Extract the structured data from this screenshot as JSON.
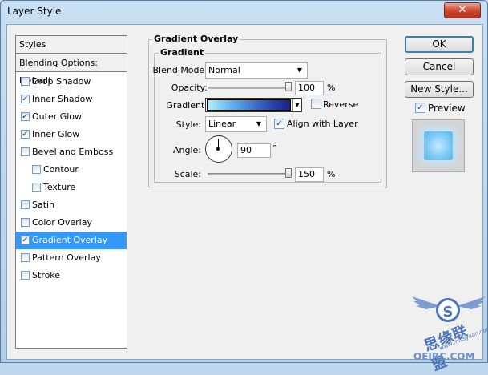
{
  "window": {
    "title": "Layer Style",
    "close_label": "✕"
  },
  "sidebar": {
    "header": "Styles",
    "blending": "Blending Options: Default",
    "items": [
      {
        "label": "Drop Shadow",
        "checked": false,
        "indent": false,
        "selected": false
      },
      {
        "label": "Inner Shadow",
        "checked": true,
        "indent": false,
        "selected": false
      },
      {
        "label": "Outer Glow",
        "checked": true,
        "indent": false,
        "selected": false
      },
      {
        "label": "Inner Glow",
        "checked": true,
        "indent": false,
        "selected": false
      },
      {
        "label": "Bevel and Emboss",
        "checked": false,
        "indent": false,
        "selected": false
      },
      {
        "label": "Contour",
        "checked": false,
        "indent": true,
        "selected": false
      },
      {
        "label": "Texture",
        "checked": false,
        "indent": true,
        "selected": false
      },
      {
        "label": "Satin",
        "checked": false,
        "indent": false,
        "selected": false
      },
      {
        "label": "Color Overlay",
        "checked": false,
        "indent": false,
        "selected": false
      },
      {
        "label": "Gradient Overlay",
        "checked": true,
        "indent": false,
        "selected": true
      },
      {
        "label": "Pattern Overlay",
        "checked": false,
        "indent": false,
        "selected": false
      },
      {
        "label": "Stroke",
        "checked": false,
        "indent": false,
        "selected": false
      }
    ]
  },
  "panel": {
    "title": "Gradient Overlay",
    "subtitle": "Gradient",
    "blend_mode_label": "Blend Mode:",
    "blend_mode_value": "Normal",
    "opacity_label": "Opacity:",
    "opacity_value": "100",
    "opacity_unit": "%",
    "opacity_level": 1.0,
    "gradient_label": "Gradient:",
    "reverse_label": "Reverse",
    "reverse_checked": false,
    "style_label": "Style:",
    "style_value": "Linear",
    "align_label": "Align with Layer",
    "align_checked": true,
    "angle_label": "Angle:",
    "angle_value": "90",
    "angle_unit": "°",
    "scale_label": "Scale:",
    "scale_value": "150",
    "scale_unit": "%",
    "scale_level": 1.0
  },
  "buttons": {
    "ok": "OK",
    "cancel": "Cancel",
    "new_style": "New Style...",
    "preview_label": "Preview",
    "preview_checked": true
  },
  "watermark": {
    "logo_letter": "S",
    "chinese": "思缘联盟",
    "url": "www.missyuan.com",
    "site": "OEIRC.COM"
  },
  "colors": {
    "selection": "#3399ff",
    "gradient_start": "#b3f0ff",
    "gradient_end": "#1a1f8c"
  }
}
